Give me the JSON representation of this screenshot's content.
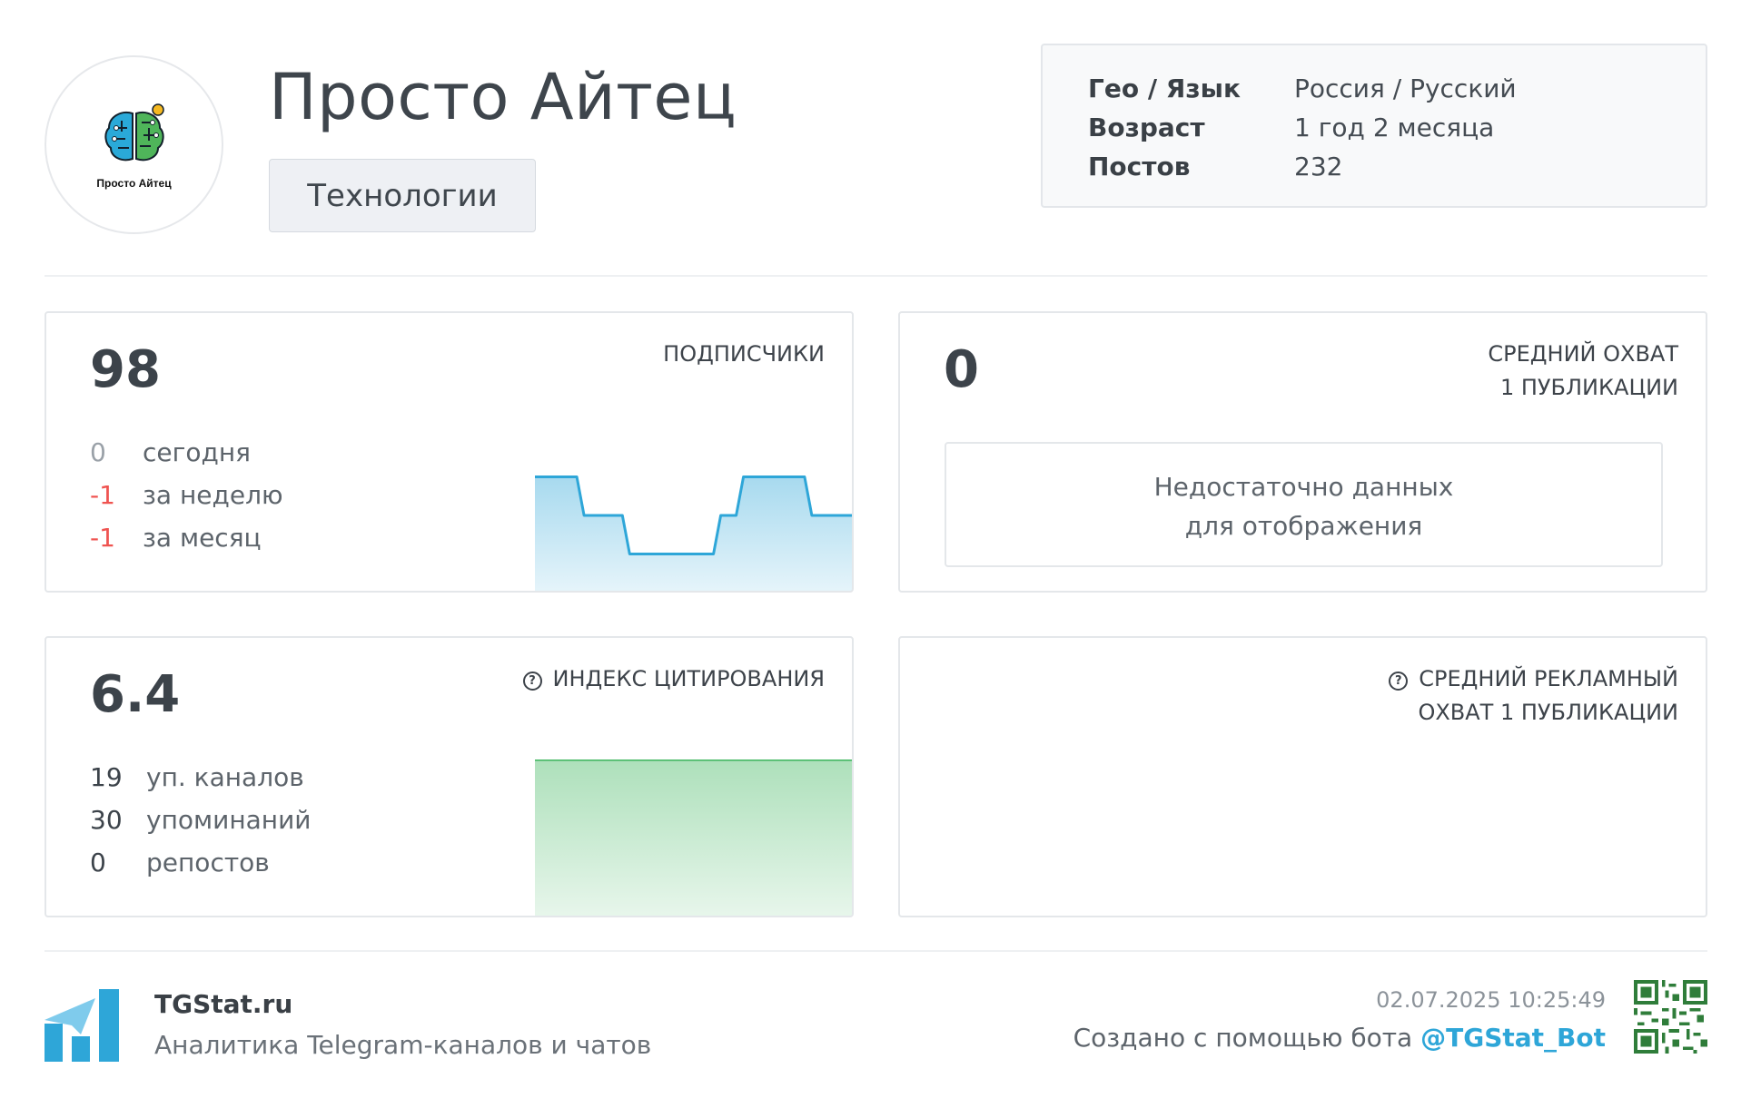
{
  "channel": {
    "title": "Просто Айтец",
    "logo_caption": "Просто Айтец",
    "category": "Технологии"
  },
  "info": [
    {
      "key": "Гео / Язык",
      "value": "Россия / Русский"
    },
    {
      "key": "Возраст",
      "value": "1 год 2 месяца"
    },
    {
      "key": "Постов",
      "value": "232"
    }
  ],
  "subscribers": {
    "value": "98",
    "label": "ПОДПИСЧИКИ",
    "rows": [
      {
        "num": "0",
        "text": "сегодня",
        "tone": "gray"
      },
      {
        "num": "-1",
        "text": "за неделю",
        "tone": "red"
      },
      {
        "num": "-1",
        "text": "за месяц",
        "tone": "red"
      }
    ],
    "color": "#2ea6d8"
  },
  "reach": {
    "value": "0",
    "label_line1": "СРЕДНИЙ ОХВАТ",
    "label_line2": "1 ПУБЛИКАЦИИ",
    "nodata_line1": "Недостаточно данных",
    "nodata_line2": "для отображения"
  },
  "citation": {
    "value": "6.4",
    "label": "ИНДЕКС ЦИТИРОВАНИЯ",
    "rows": [
      {
        "num": "19",
        "text": "уп. каналов"
      },
      {
        "num": "30",
        "text": "упоминаний"
      },
      {
        "num": "0",
        "text": "репостов"
      }
    ],
    "color": "#3cb55c"
  },
  "ad_reach": {
    "label_line1": "СРЕДНИЙ РЕКЛАМНЫЙ",
    "label_line2": "ОХВАТ 1 ПУБЛИКАЦИИ"
  },
  "chart_data": [
    {
      "type": "area",
      "title": "ПОДПИСЧИКИ",
      "x": [
        1,
        2,
        3,
        4,
        5,
        6,
        7,
        8,
        9,
        10,
        11,
        12,
        13,
        14
      ],
      "values": [
        99,
        99,
        98,
        98,
        97,
        97,
        97,
        97,
        98,
        99,
        99,
        99,
        98,
        98
      ],
      "ylim": [
        96,
        100
      ],
      "grid": false
    },
    {
      "type": "area",
      "title": "ИНДЕКС ЦИТИРОВАНИЯ",
      "x": [
        1,
        2
      ],
      "values": [
        6.4,
        6.4
      ],
      "grid": false
    }
  ],
  "footer": {
    "site": "TGStat.ru",
    "tagline": "Аналитика Telegram-каналов и чатов",
    "date": "02.07.2025 10:25:49",
    "created_by": "Создано с помощью бота ",
    "bot": "@TGStat_Bot"
  }
}
